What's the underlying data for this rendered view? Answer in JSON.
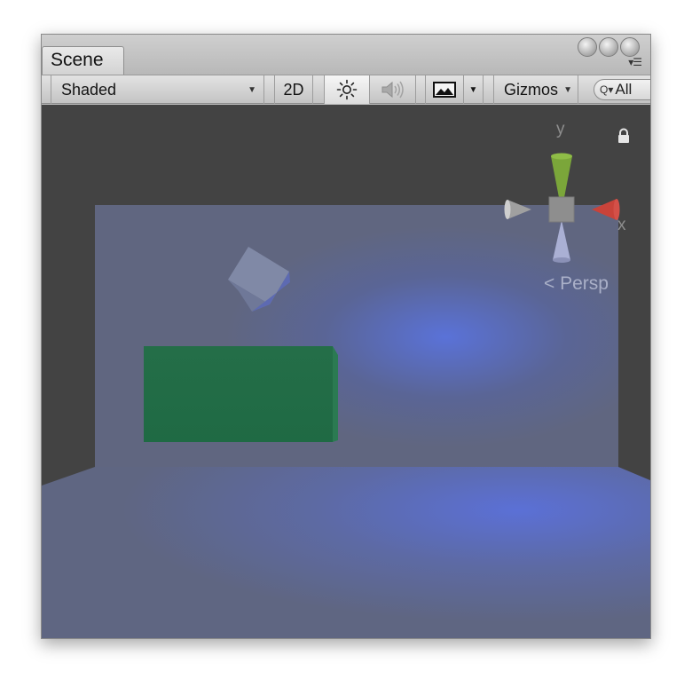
{
  "window": {
    "tab_label": "Scene"
  },
  "toolbar": {
    "draw_mode": {
      "label": "Shaded",
      "icon": "dropdown-arrow-icon"
    },
    "mode_2d": {
      "label": "2D"
    },
    "lighting": {
      "icon": "sun-icon",
      "active": true
    },
    "audio": {
      "icon": "speaker-icon",
      "active": false
    },
    "effects": {
      "icon": "landscape-image-icon",
      "dropdown_icon": "dropdown-arrow-icon"
    },
    "gizmos": {
      "label": "Gizmos",
      "icon": "dropdown-arrow-icon"
    },
    "search": {
      "value": "All",
      "icon": "search-icon"
    }
  },
  "viewport": {
    "background_color": "#434343",
    "projection_label": "Persp",
    "gizmo": {
      "y_label": "y",
      "x_label": "x",
      "y_color": "#7ba63a",
      "x_color": "#c9433a"
    },
    "objects": {
      "cube_color": "#7f88a8",
      "box_color": "#23704a",
      "light_color": "#5a72d8"
    }
  }
}
